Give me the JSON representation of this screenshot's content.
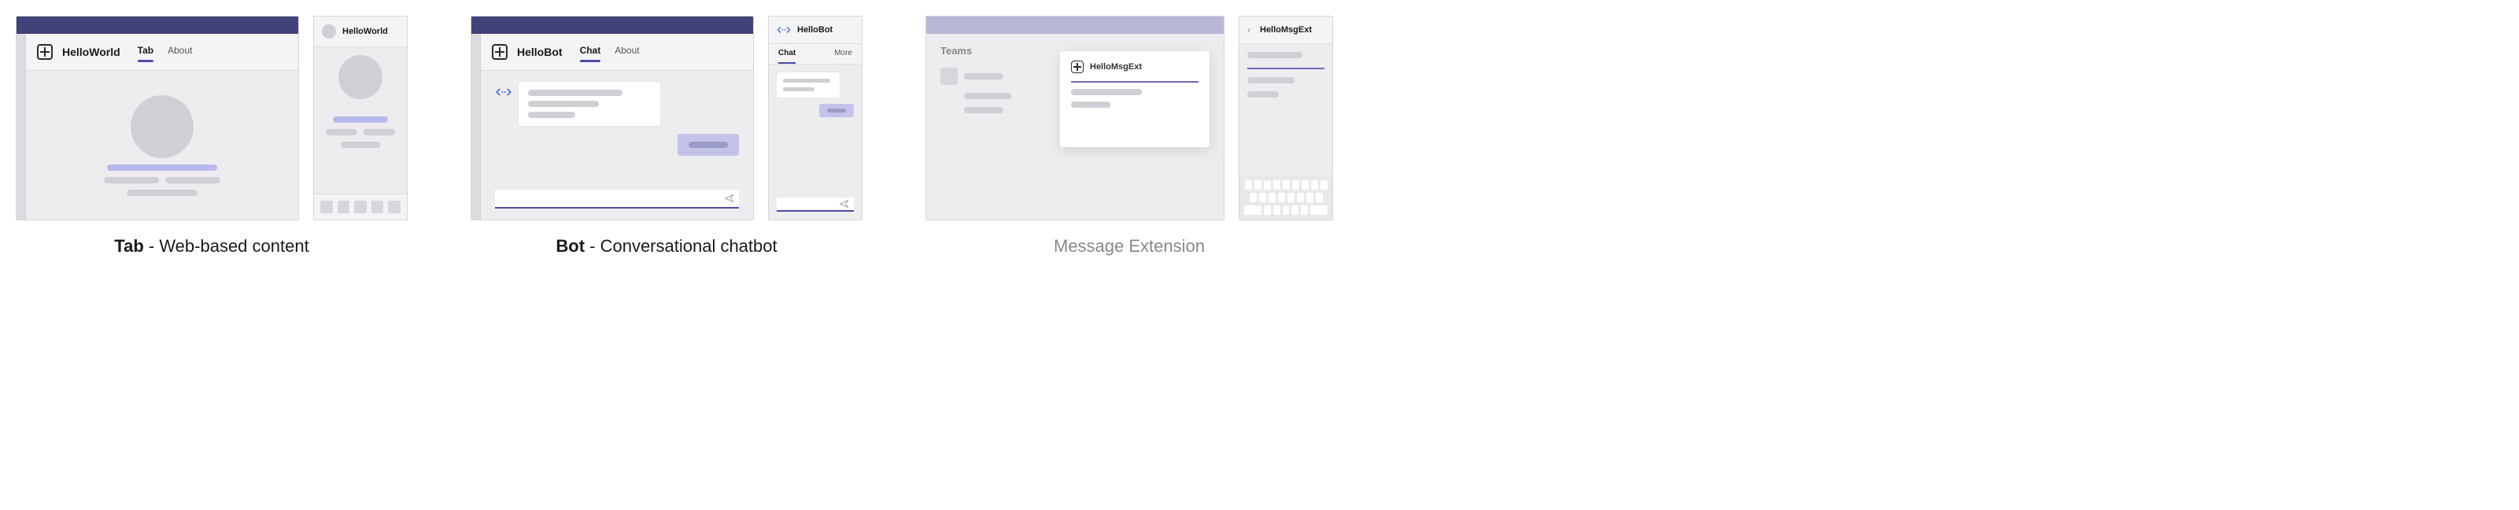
{
  "tab": {
    "caption_bold": "Tab",
    "caption_rest": " - Web-based content",
    "desktop": {
      "title": "HelloWorld",
      "tabs": [
        "Tab",
        "About"
      ],
      "active_tab": 0
    },
    "mobile": {
      "title": "HelloWorld"
    }
  },
  "bot": {
    "caption_bold": "Bot",
    "caption_rest": " - Conversational chatbot",
    "desktop": {
      "title": "HelloBot",
      "tabs": [
        "Chat",
        "About"
      ],
      "active_tab": 0
    },
    "mobile": {
      "title": "HelloBot",
      "tabs": [
        "Chat",
        "More"
      ],
      "active_tab": 0
    }
  },
  "msgext": {
    "caption": "Message Extension",
    "desktop": {
      "heading": "Teams",
      "popup_title": "HelloMsgExt"
    },
    "mobile": {
      "title": "HelloMsgExt"
    }
  }
}
